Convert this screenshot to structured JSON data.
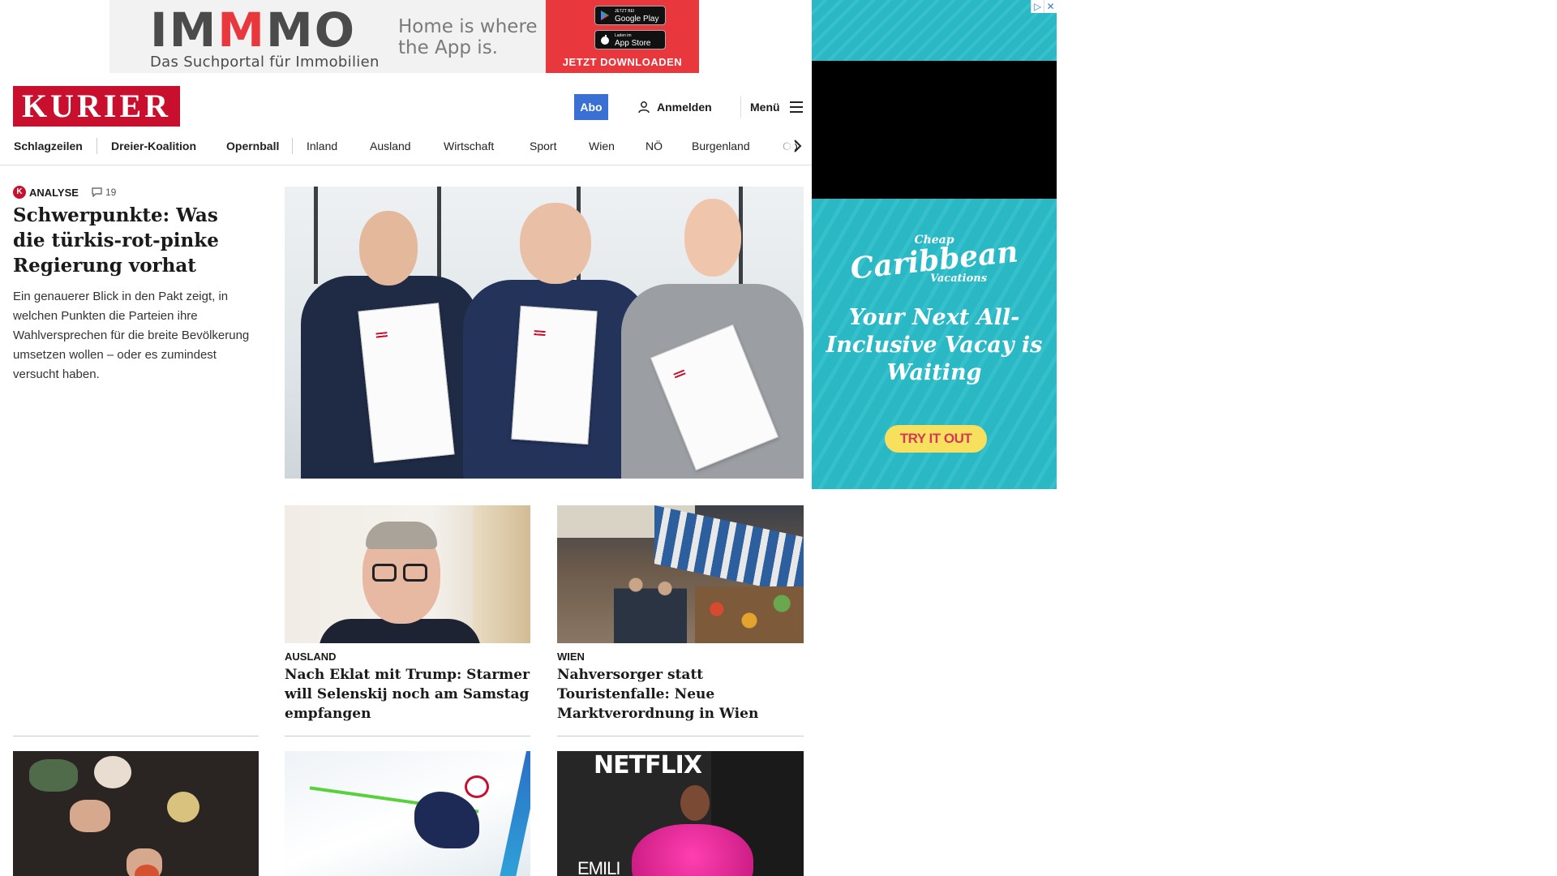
{
  "top_ad": {
    "logo_left": "IM",
    "logo_mid": "M",
    "logo_right": "MO",
    "subtitle": "Das Suchportal für Immobilien",
    "tagline": "Home is where the App is.",
    "google_small": "JETZT BEI",
    "google_big": "Google Play",
    "apple_small": "Laden im",
    "apple_big": "App Store",
    "cta": "JETZT DOWNLOADEN",
    "accent_color": "#e8383d"
  },
  "side_ad": {
    "brand_top": "Cheap",
    "brand_main": "Caribbean",
    "brand_bottom": "Vacations",
    "headline": "Your Next All-Inclusive Vacay is Waiting",
    "button": "TRY IT OUT",
    "adchoice_icon": "▷",
    "close_icon": "✕"
  },
  "header": {
    "logo": "KURIER",
    "abo": "Abo",
    "login": "Anmelden",
    "menu": "Menü",
    "brand_color": "#c8102e",
    "abo_color": "#3a6fd4"
  },
  "nav": {
    "items": [
      "Schlagzeilen",
      "Dreier-Koalition",
      "Opernball",
      "Inland",
      "Ausland",
      "Wirtschaft",
      "Sport",
      "Wien",
      "NÖ",
      "Burgenland",
      "Oö"
    ]
  },
  "lead": {
    "badge": "K",
    "kind": "ANALYSE",
    "comments": "19",
    "title": "Schwerpunkte: Was die türkis-rot-pinke Regierung vorhat",
    "teaser": "Ein genauerer Blick in den Pakt zeigt, in welchen Punkten die Parteien ihre Wahlversprechen für die breite Bevölkerung umsetzen wollen – oder es zumindest versucht haben."
  },
  "cards": [
    {
      "kicker": "AUSLAND",
      "title": "Nach Eklat mit Trump: Starmer will Selenskij noch am Samstag empfangen"
    },
    {
      "kicker": "WIEN",
      "title": "Nahversorger statt Touristenfalle: Neue Marktverordnung in Wien"
    }
  ],
  "bottom_images": {
    "netflix_logo": "NETFLIX",
    "netflix_sign": "EMILI"
  }
}
